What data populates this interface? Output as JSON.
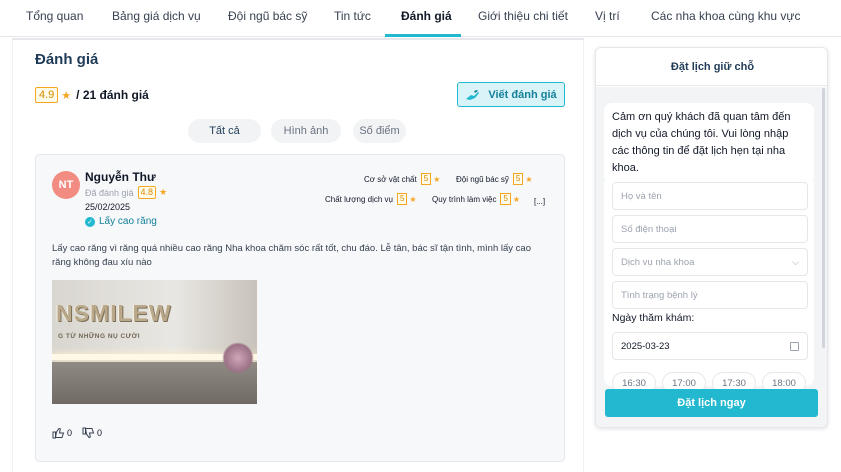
{
  "tabs": [
    {
      "label": "Tổng quan"
    },
    {
      "label": "Bảng giá dịch vụ"
    },
    {
      "label": "Đội ngũ bác sỹ"
    },
    {
      "label": "Tin tức"
    },
    {
      "label": "Đánh giá"
    },
    {
      "label": "Giới thiệu chi tiết"
    },
    {
      "label": "Vị trí"
    },
    {
      "label": "Các nha khoa cùng khu vực"
    }
  ],
  "active_tab": "Đánh giá",
  "reviews": {
    "title": "Đánh giá",
    "score": "4.9",
    "count_text": "/ 21 đánh giá",
    "write_button": "Viết đánh giá",
    "filters": [
      "Tất cả",
      "Hình ảnh",
      "Số điểm"
    ]
  },
  "review": {
    "avatar_initials": "NT",
    "author": "Nguyễn Thư",
    "rated_label": "Đã đánh giá",
    "rated_score": "4.8",
    "date": "25/02/2025",
    "service": "Lấy cao răng",
    "criteria": [
      {
        "label": "Cơ sở vật chất",
        "score": "5"
      },
      {
        "label": "Đội ngũ bác sỹ",
        "score": "5"
      },
      {
        "label": "Chất lượng dịch vụ",
        "score": "5"
      },
      {
        "label": "Quy trình làm việc",
        "score": "5"
      }
    ],
    "more": "[...]",
    "text": "Lấy cao răng vì răng quá nhiều cao răng Nha khoa chăm sóc rất tốt, chu đáo. Lễ tân, bác sĩ tận tình, mình lấy cao răng không đau xíu nào",
    "photo_logo": "NSMILEW",
    "photo_slogan": "G TỪ NHỮNG NỤ CƯỜI",
    "likes": "0",
    "dislikes": "0"
  },
  "booking": {
    "title": "Đặt lịch giữ chỗ",
    "message": "Cảm ơn quý khách đã quan tâm đến dịch vụ của chúng tôi. Vui lòng nhập các thông tin để đặt lịch hẹn tại nha khoa.",
    "name_placeholder": "Họ và tên",
    "phone_placeholder": "Số điện thoại",
    "service_placeholder": "Dịch vụ nha khoa",
    "condition_placeholder": "Tình trạng bệnh lý",
    "date_label": "Ngày thăm khám:",
    "date_value": "2025-03-23",
    "time_slots": [
      "16:30",
      "17:00",
      "17:30",
      "18:00"
    ],
    "submit": "Đặt lịch ngay"
  },
  "colors": {
    "accent": "#22b8cf",
    "star": "#f5a623",
    "avatar": "#f28b82"
  }
}
